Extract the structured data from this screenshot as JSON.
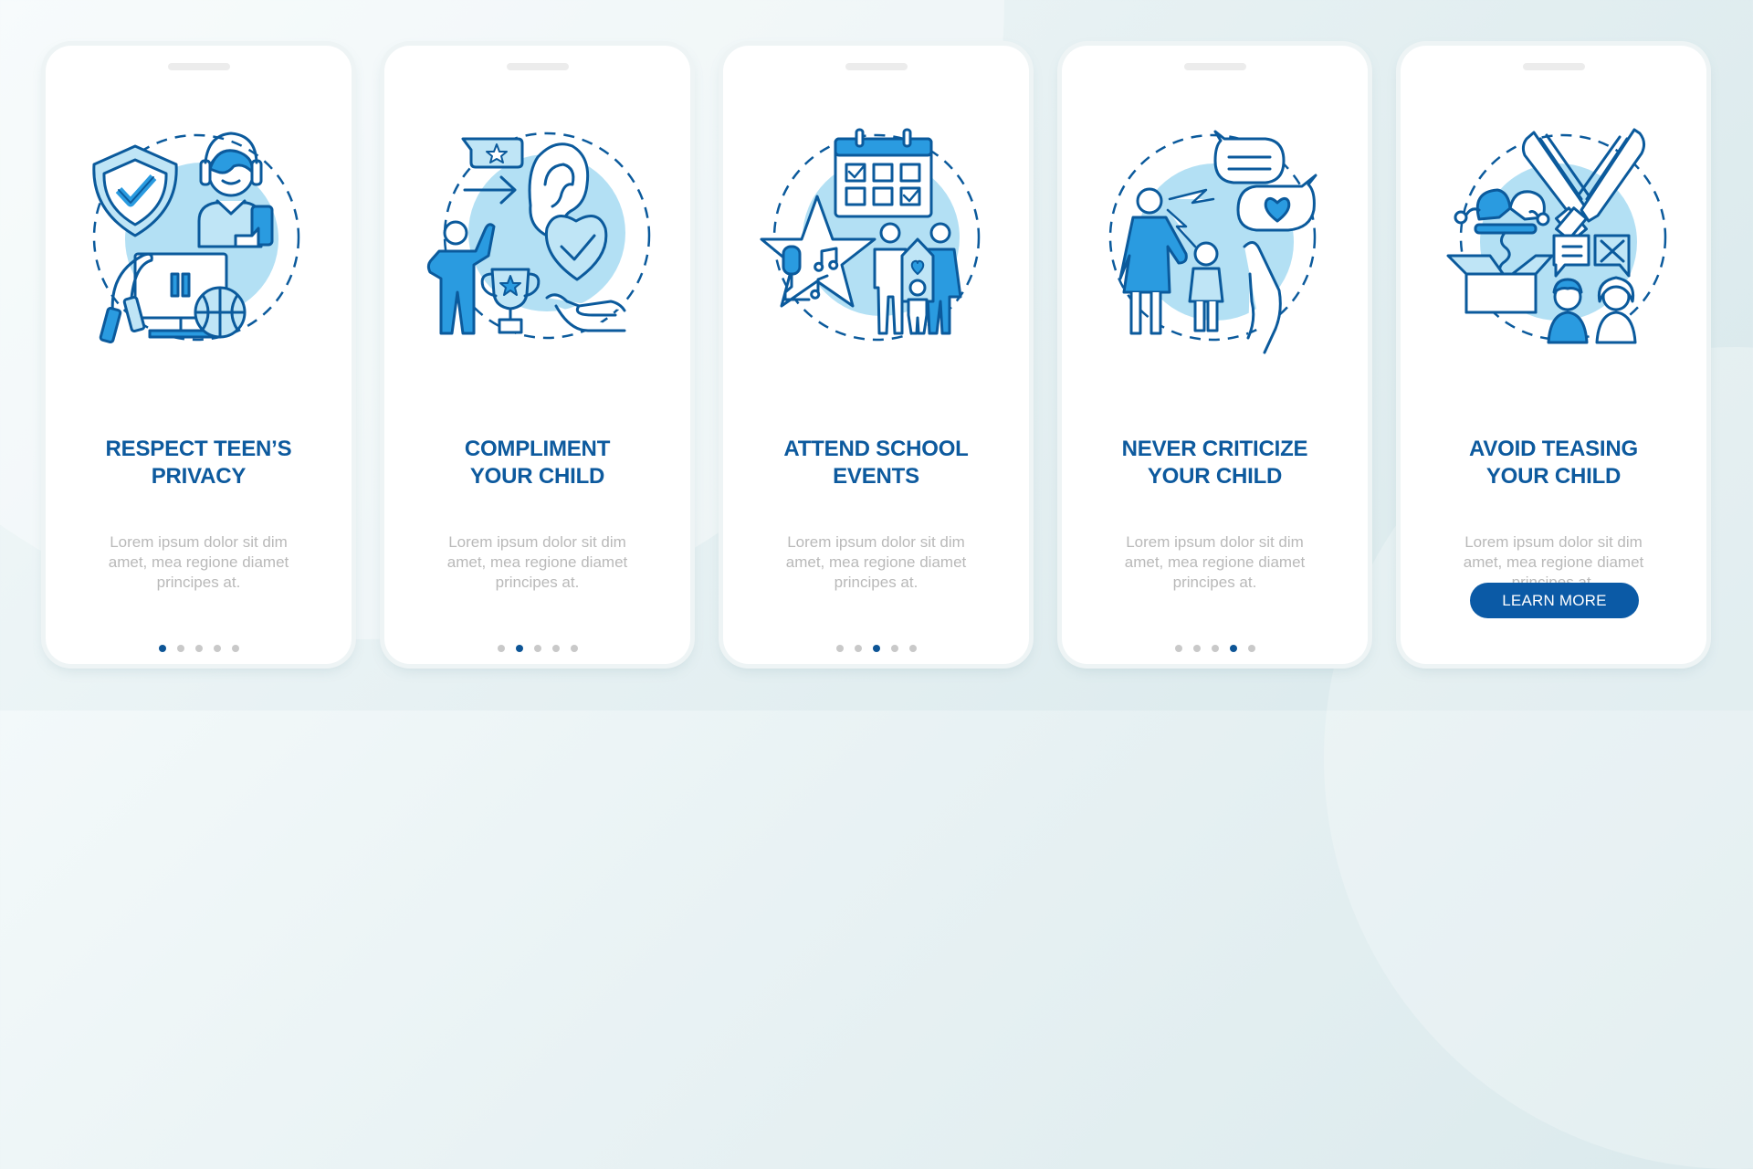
{
  "theme": {
    "title_color": "#0d5a9e",
    "body_color": "#b9b9b9",
    "accent": "#0b5aa6",
    "dot_active": "#0d5596",
    "dot_inactive": "#c9c9c9",
    "illustration_stroke": "#0b5a9c",
    "illustration_fill": "#2a9be0",
    "illustration_light": "#b3e0f4"
  },
  "cards": [
    {
      "illustration": "teen-privacy-illustration",
      "title_lines": [
        "RESPECT TEEN’S",
        "PRIVACY"
      ],
      "body_lines": [
        "Lorem ipsum dolor sit dim",
        "amet, mea regione diamet",
        "principes at."
      ],
      "page_index": 1,
      "page_count": 5
    },
    {
      "illustration": "compliment-child-illustration",
      "title_lines": [
        "COMPLIMENT",
        "YOUR CHILD"
      ],
      "body_lines": [
        "Lorem ipsum dolor sit dim",
        "amet, mea regione diamet",
        "principes at."
      ],
      "page_index": 2,
      "page_count": 5
    },
    {
      "illustration": "school-events-illustration",
      "title_lines": [
        "ATTEND SCHOOL",
        "EVENTS"
      ],
      "body_lines": [
        "Lorem ipsum dolor sit dim",
        "amet, mea regione diamet",
        "principes at."
      ],
      "page_index": 3,
      "page_count": 5
    },
    {
      "illustration": "never-criticize-illustration",
      "title_lines": [
        "NEVER CRITICIZE",
        "YOUR CHILD"
      ],
      "body_lines": [
        "Lorem ipsum dolor sit dim",
        "amet, mea regione diamet",
        "principes at."
      ],
      "page_index": 4,
      "page_count": 5
    },
    {
      "illustration": "avoid-teasing-illustration",
      "title_lines": [
        "AVOID TEASING",
        "YOUR CHILD"
      ],
      "body_lines": [
        "Lorem ipsum dolor sit dim",
        "amet, mea regione diamet",
        "principes at."
      ],
      "page_index": 5,
      "page_count": 5,
      "button_label": "LEARN MORE"
    }
  ]
}
